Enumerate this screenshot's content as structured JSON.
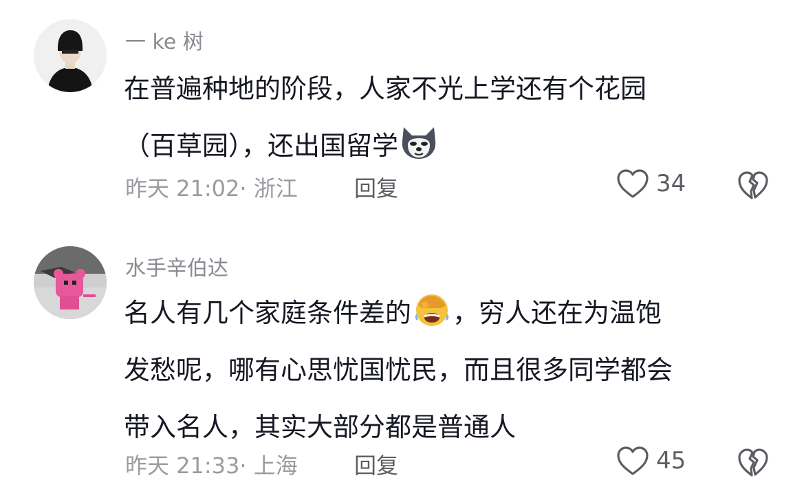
{
  "comments": [
    {
      "username": "一 ke 树",
      "lines": [
        "在普遍种地的阶段，人家不光上学还有个花园",
        "（百草园），还出国留学"
      ],
      "emoji_after_line": 1,
      "emoji": "husky-doge-icon",
      "time_location": "昨天 21:02· 浙江",
      "reply_label": "回复",
      "like_count": "34"
    },
    {
      "username": "水手辛伯达",
      "lines_part": {
        "first_before_emoji": "名人有几个家庭条件差的",
        "first_after_emoji": "，穷人还在为温饱",
        "rest": [
          "发愁呢，哪有心思忧国忧民，而且很多同学都会",
          "带入名人，其实大部分都是普通人"
        ]
      },
      "emoji": "facepalm-laugh-icon",
      "time_location": "昨天 21:33· 上海",
      "reply_label": "回复",
      "like_count": "45"
    }
  ],
  "colors": {
    "text": "#161823",
    "username": "#8a8b91",
    "meta": "#9a9ba0",
    "action": "#5c5d63"
  }
}
